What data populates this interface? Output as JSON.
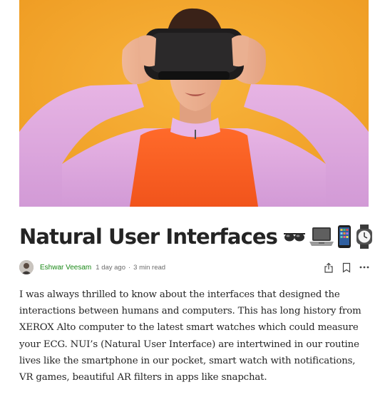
{
  "article": {
    "title": "Natural User Interfaces",
    "title_emojis": [
      "glasses-icon",
      "laptop-icon",
      "mobile-phone-icon",
      "watch-icon"
    ],
    "author": "Eshwar Veesam",
    "published": "1 day ago",
    "separator": "·",
    "read_time": "3 min read",
    "body": "I was always thrilled to know about the interfaces that designed the interactions between humans and computers. This has long history from XEROX Alto computer to the latest smart watches which could measure your ECG. NUI’s (Natural User Interface) are intertwined in our routine lives like the smartphone in our pocket, smart watch with notifications, VR games, beautiful AR filters in apps like snapchat."
  },
  "actions": [
    {
      "icon": "share-icon"
    },
    {
      "icon": "bookmark-icon"
    },
    {
      "icon": "more-icon"
    }
  ],
  "colors": {
    "hero_background": "#f3a52a",
    "author_link": "#1a8917",
    "meta_text": "#6b6b6b",
    "text": "#242424"
  }
}
